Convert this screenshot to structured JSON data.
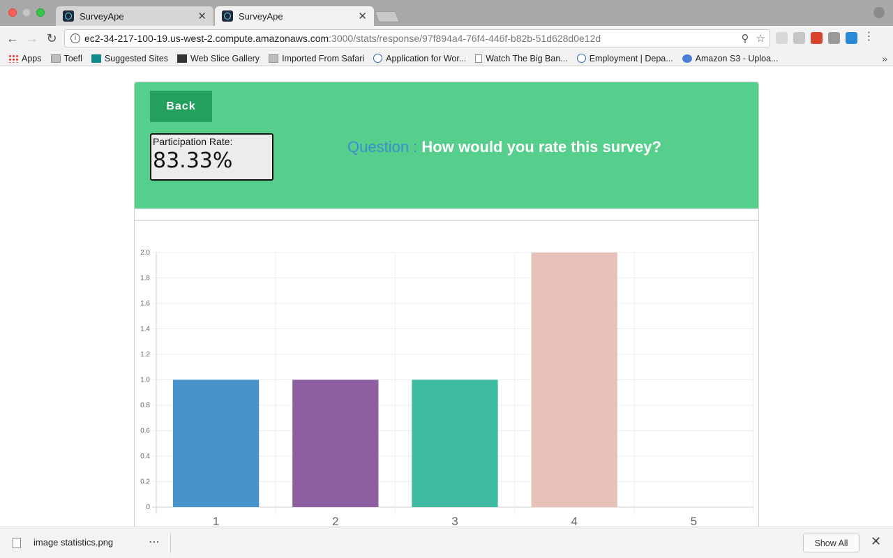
{
  "browser": {
    "tabs": [
      {
        "title": "SurveyApe",
        "active": false
      },
      {
        "title": "SurveyApe",
        "active": true
      }
    ],
    "url_host": "ec2-34-217-100-19.us-west-2.compute.amazonaws.com",
    "url_path": ":3000/stats/response/97f894a4-76f4-446f-b82b-51d628d0e12d",
    "bookmarks": [
      "Apps",
      "Toefl",
      "Suggested Sites",
      "Web Slice Gallery",
      "Imported From Safari",
      "Application for Wor...",
      "Watch The Big Ban...",
      "Employment | Depa...",
      "Amazon S3 - Uploa..."
    ]
  },
  "page": {
    "back_label": "Back",
    "participation_label": "Participation Rate:",
    "participation_value": "83.33%",
    "question_label": "Question :",
    "question_text": "How would you rate this survey?"
  },
  "colors": {
    "header_bg": "#56cf8d",
    "back_button": "#23a05c",
    "question_label": "#3b8fcc"
  },
  "chart_data": {
    "type": "bar",
    "categories": [
      "1",
      "2",
      "3",
      "4",
      "5"
    ],
    "values": [
      1,
      1,
      1,
      2,
      0
    ],
    "bar_colors": [
      "#4694cb",
      "#8e5ea2",
      "#3ebca1",
      "#e6c2b9",
      "#cccccc"
    ],
    "y_ticks": [
      "0",
      "0.2",
      "0.4",
      "0.6",
      "0.8",
      "1.0",
      "1.2",
      "1.4",
      "1.6",
      "1.8",
      "2.0"
    ],
    "ylim": [
      0,
      2
    ],
    "grid": true
  },
  "downloads": {
    "file_name": "image statistics.png",
    "show_all_label": "Show All"
  }
}
